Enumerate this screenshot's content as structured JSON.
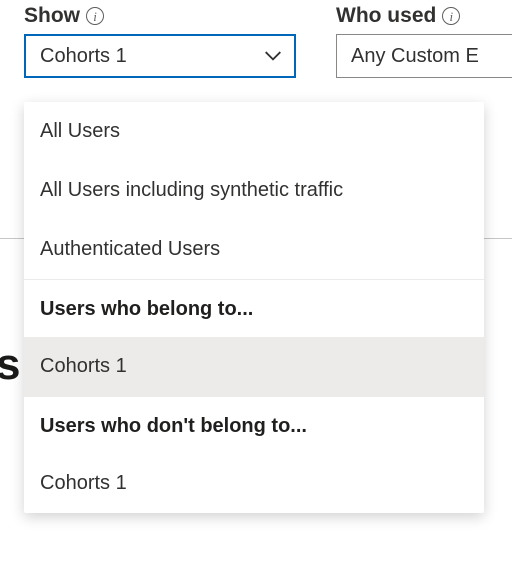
{
  "fields": {
    "show": {
      "label": "Show",
      "selected": "Cohorts 1"
    },
    "who_used": {
      "label": "Who used",
      "selected": "Any Custom E"
    }
  },
  "dropdown": {
    "items": [
      {
        "label": "All Users",
        "type": "item"
      },
      {
        "label": "All Users including synthetic traffic",
        "type": "item"
      },
      {
        "label": "Authenticated Users",
        "type": "item"
      }
    ],
    "group1": {
      "header": "Users who belong to...",
      "item": "Cohorts 1"
    },
    "group2": {
      "header": "Users who don't belong to...",
      "item": "Cohorts 1"
    }
  },
  "partial_text": "s"
}
